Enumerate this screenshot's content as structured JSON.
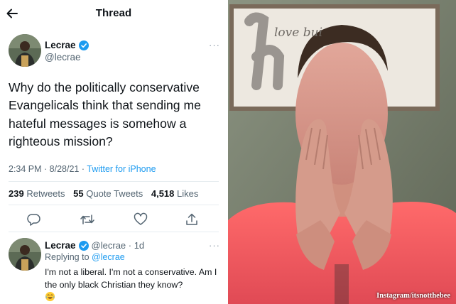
{
  "thread": {
    "title": "Thread",
    "colors": {
      "accent": "#1d9bf0",
      "text": "#0f1419",
      "muted": "#536471"
    },
    "tweet": {
      "name": "Lecrae",
      "handle": "@lecrae",
      "text": "Why do the politically conservative Evangelicals think that sending me hateful messages is somehow a righteous mission?",
      "time": "2:34 PM · 8/28/21 · ",
      "source": "Twitter for iPhone",
      "retweets_count": "239",
      "retweets_label": "Retweets",
      "quotes_count": "55",
      "quotes_label": "Quote Tweets",
      "likes_count": "4,518",
      "likes_label": "Likes",
      "more": "···"
    },
    "reply": {
      "name": "Lecrae",
      "handle_age": "@lecrae · 1d",
      "replying_prefix": "Replying to ",
      "replying_to": "@lecrae",
      "text": "I'm not a liberal. I'm not a conservative. Am I the only black Christian they know?",
      "emoji_icon": "laughing-tears-icon",
      "more": "···"
    }
  },
  "photo": {
    "sign_text": "love bui",
    "credit": "Instagram/itsnotthebee"
  }
}
